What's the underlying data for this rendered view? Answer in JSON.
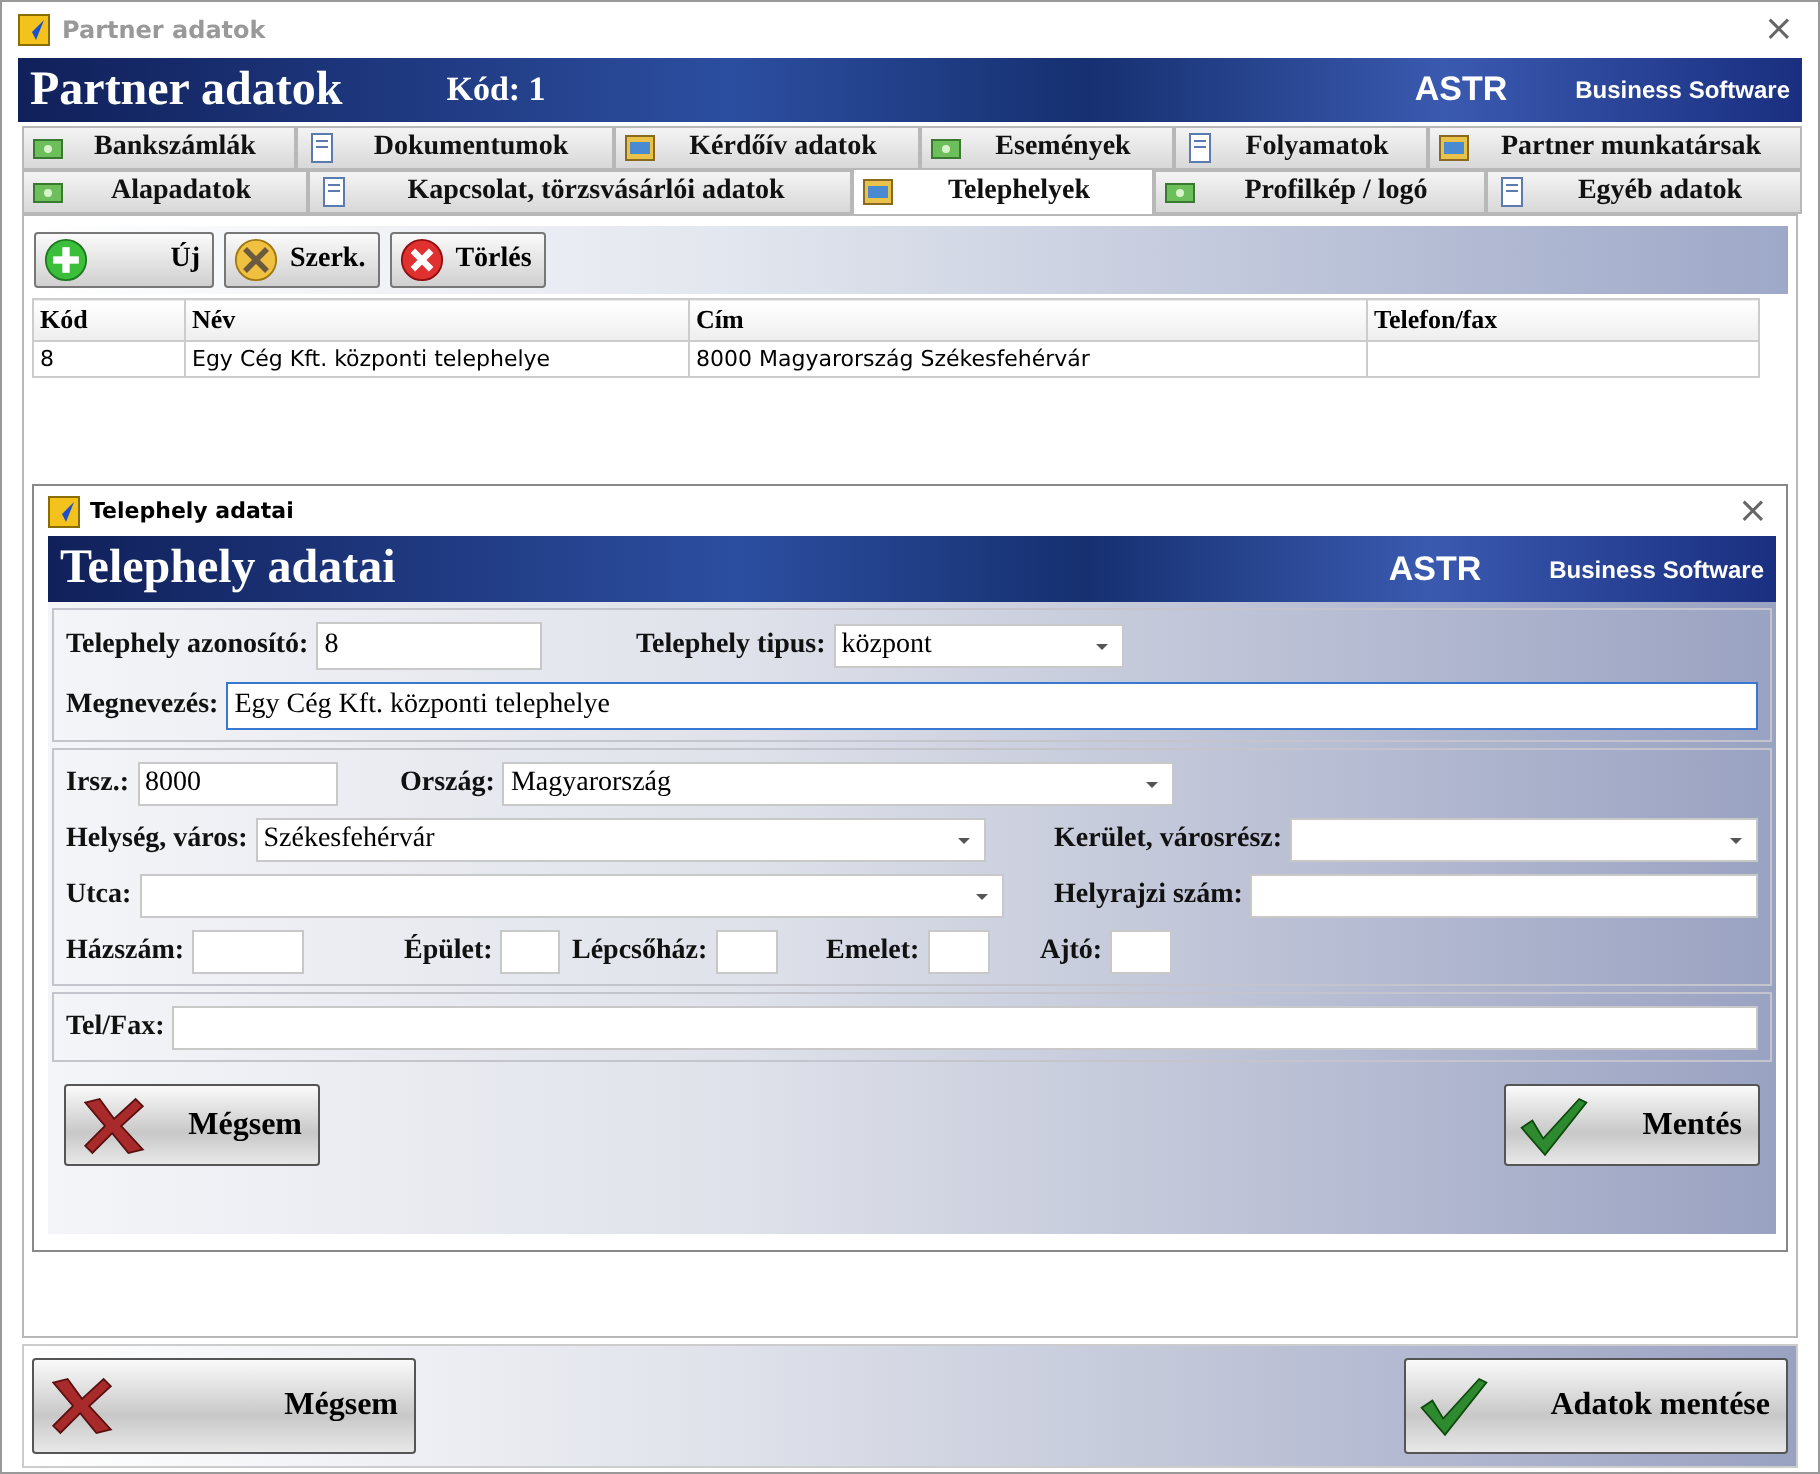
{
  "window": {
    "title": "Partner adatok",
    "close": "×"
  },
  "header": {
    "title": "Partner adatok",
    "code": "Kód: 1",
    "brand": "ASTR",
    "brand_subtitle": "Business Software"
  },
  "tab_rows": [
    [
      {
        "label": "Bankszámlák",
        "selected": false
      },
      {
        "label": "Dokumentumok",
        "selected": false
      },
      {
        "label": "Kérdőív adatok",
        "selected": false
      },
      {
        "label": "Események",
        "selected": false
      },
      {
        "label": "Folyamatok",
        "selected": false
      },
      {
        "label": "Partner munkatársak",
        "selected": false
      }
    ],
    [
      {
        "label": "Alapadatok",
        "selected": false
      },
      {
        "label": "Kapcsolat, törzsvásárlói adatok",
        "selected": false
      },
      {
        "label": "Telephelyek",
        "selected": true
      },
      {
        "label": "Profilkép / logó",
        "selected": false
      },
      {
        "label": "Egyéb adatok",
        "selected": false
      }
    ]
  ],
  "toolbar": [
    {
      "label": "Új",
      "kind": "add"
    },
    {
      "label": "Szerk.",
      "kind": "edit"
    },
    {
      "label": "Törlés",
      "kind": "delete"
    }
  ],
  "table": {
    "columns": [
      "Kód",
      "Név",
      "Cím",
      "Telefon/fax"
    ],
    "rows": [
      [
        "8",
        "Egy Cég Kft. központi telephelye",
        "8000 Magyarország Székesfehérvár",
        ""
      ]
    ]
  },
  "dialog": {
    "title": "Telephely adatai",
    "close": "×",
    "header_title": "Telephely adatai",
    "brand": "ASTR",
    "brand_subtitle": "Business Software",
    "sections": [
      [
        [
          {
            "label": "Telephely azonosító:",
            "value": "8",
            "kind": "text",
            "focused": false
          },
          {
            "label": "Telephely tipus:",
            "value": "központ",
            "kind": "select",
            "focused": false
          }
        ],
        [
          {
            "label": "Megnevezés:",
            "value": "Egy Cég Kft. központi telephelye",
            "kind": "text",
            "focused": true
          }
        ]
      ],
      [
        [
          {
            "label": "Irsz.:",
            "value": "8000",
            "kind": "text",
            "focused": false
          },
          {
            "label": "Ország:",
            "value": "Magyarország",
            "kind": "select",
            "focused": false
          }
        ],
        [
          {
            "label": "Helység, város:",
            "value": "Székesfehérvár",
            "kind": "select",
            "focused": false
          },
          {
            "label": "Kerület, városrész:",
            "kind": "select",
            "focused": false
          }
        ],
        [
          {
            "label": "Utca:",
            "kind": "select",
            "focused": false
          },
          {
            "label": "Helyrajzi szám:",
            "kind": "text",
            "focused": false
          }
        ],
        [
          {
            "label": "Házszám:",
            "kind": "text",
            "focused": false
          },
          {
            "label": "Épület:",
            "kind": "text",
            "focused": false
          },
          {
            "label": "Lépcsőház:",
            "kind": "text",
            "focused": false
          },
          {
            "label": "Emelet:",
            "kind": "text",
            "focused": false
          },
          {
            "label": "Ajtó:",
            "kind": "text",
            "focused": false
          }
        ]
      ],
      [
        [
          {
            "label": "Tel/Fax:",
            "kind": "text",
            "focused": false
          }
        ]
      ]
    ],
    "buttons": [
      {
        "label": "Mégsem",
        "kind": "cancel"
      },
      {
        "label": "Mentés",
        "kind": "save"
      }
    ]
  },
  "footer": [
    {
      "label": "Mégsem",
      "kind": "cancel"
    },
    {
      "label": "Adatok mentése",
      "kind": "save"
    }
  ]
}
